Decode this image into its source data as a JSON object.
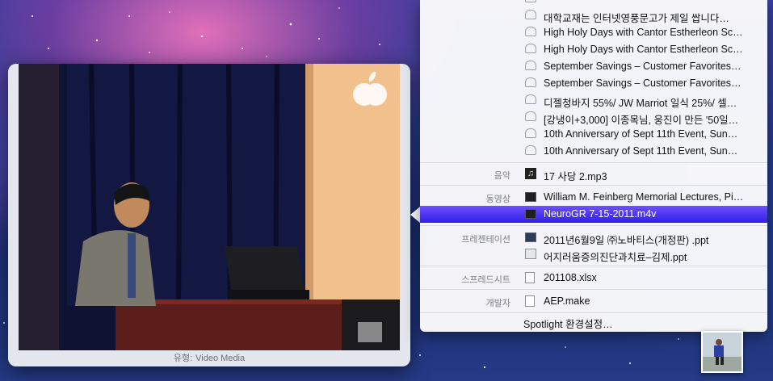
{
  "preview": {
    "type_label": "유형:",
    "type_value": "Video Media"
  },
  "menu": {
    "mail_items": [
      "대학교재는 인터넷영풍문고가 제일 쌉니다…",
      "High Holy Days with Cantor Estherleon Sc…",
      "High Holy Days with Cantor Estherleon Sc…",
      "September Savings – Customer Favorites…",
      "September Savings – Customer Favorites…",
      "디젤청바지 55%/ JW Marriot 일식 25%/ 셀…",
      "[강냉이+3,000] 이종목님, 웅진이 만든 '50일…",
      "10th Anniversary of Sept 11th Event, Sun…",
      "10th Anniversary of Sept 11th Event, Sun…"
    ],
    "music": {
      "category": "음악",
      "name": "17 사당 2.mp3"
    },
    "movies": {
      "category": "동영상",
      "items": [
        "William M. Feinberg Memorial Lectures, Pi…",
        "NeuroGR 7-15-2011.m4v"
      ]
    },
    "presentations": {
      "category": "프레젠테이션",
      "items": [
        "2011년6월9일 ㈜노바티스(개정판) .ppt",
        "어지러움증의진단과치료–김제.ppt"
      ]
    },
    "spreadsheets": {
      "category": "스프레드시트",
      "name": "201108.xlsx"
    },
    "developer": {
      "category": "개발자",
      "name": "AEP.make"
    },
    "settings_label": "Spotlight 환경설정…"
  },
  "colors": {
    "selection": "#2f1fe6",
    "menu_bg": "#fafafc"
  }
}
